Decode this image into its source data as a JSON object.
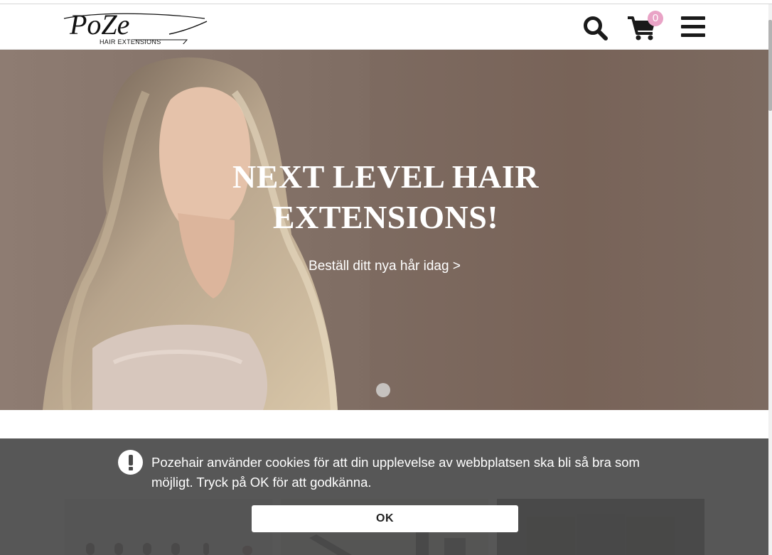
{
  "brand": {
    "logo_word": "PoZe",
    "logo_tagline": "HAIR EXTENSIONS"
  },
  "header": {
    "search_icon": "search-icon",
    "cart_icon": "cart-icon",
    "menu_icon": "hamburger-menu-icon",
    "cart_count": "0",
    "colors": {
      "badge": "#e9a3c6",
      "icons": "#1a1a1a"
    }
  },
  "hero": {
    "title": "NEXT LEVEL HAIR EXTENSIONS!",
    "cta": "Beställ ditt nya hår idag >",
    "slides_total": 1,
    "active_slide": 1,
    "colors": {
      "background": "#7e6b61",
      "text": "#ffffff"
    }
  },
  "cookie_banner": {
    "icon": "exclamation-icon",
    "message": "Pozehair använder cookies för att din upplevelse av webbplatsen ska bli så bra som möjligt. Tryck på OK för att godkänna.",
    "ok_label": "OK",
    "colors": {
      "background": "#4a4a4a",
      "text": "#ffffff"
    }
  }
}
